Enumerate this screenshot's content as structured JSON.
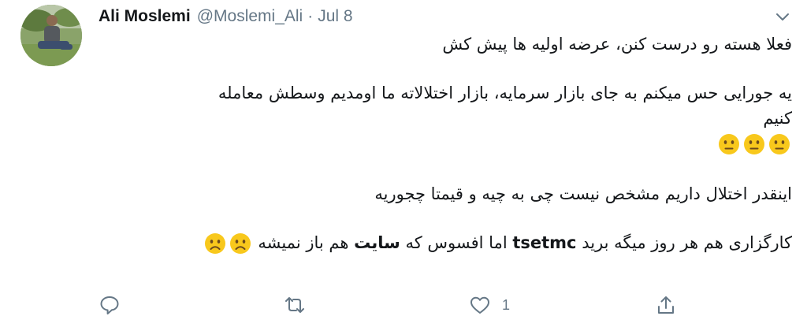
{
  "author": {
    "name": "Ali Moslemi",
    "handle": "@Moslemi_Ali",
    "separator": "·",
    "date": "Jul 8"
  },
  "tweet": {
    "line1": "فعلا هسته رو درست کنن، عرضه اولیه ها پیش کش",
    "line2": "یه جورایی حس میکنم به جای بازار سرمایه، بازار اختلالاته ما اومدیم وسطش معامله",
    "line3": "کنیم",
    "emoji_row1": [
      "neutral-face",
      "neutral-face",
      "neutral-face"
    ],
    "line4": "اینقدر اختلال داریم مشخص نیست چی به چیه و قیمتا چجوریه",
    "line5_part1": "کارگزاری هم هر روز میگه برید",
    "line5_tsetmc": "tsetmc",
    "line5_part2": "اما افسوس که",
    "line5_site": "سایت",
    "line5_part3": "هم باز نمیشه",
    "emoji_row2": [
      "frowning-face",
      "frowning-face"
    ]
  },
  "actions": {
    "reply_count": "",
    "retweet_count": "",
    "like_count": "1",
    "share_count": ""
  },
  "colors": {
    "text": "#14171a",
    "secondary": "#657786",
    "emoji": "#f8c81c",
    "emoji_dark": "#6b4a1c"
  }
}
